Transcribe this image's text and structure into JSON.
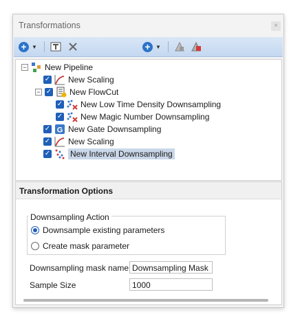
{
  "window": {
    "title": "Transformations",
    "close_glyph": "×"
  },
  "toolbar": {
    "add_icon": "plus-circle-icon",
    "text_icon": "text-box-icon",
    "delete_icon": "x-delete-icon",
    "add2_icon": "plus-circle-icon",
    "gate_icon": "gate-icon",
    "gate2_icon": "gate-colored-icon"
  },
  "tree": {
    "root": "New Pipeline",
    "items": [
      {
        "label": "New Scaling",
        "icon": "scaling-icon"
      },
      {
        "label": "New FlowCut",
        "icon": "flowcut-icon"
      },
      {
        "label": "New Low Time Density Downsampling",
        "icon": "downsample-icon"
      },
      {
        "label": "New Magic Number Downsampling",
        "icon": "downsample-icon"
      },
      {
        "label": "New Gate Downsampling",
        "icon": "gate-g-icon"
      },
      {
        "label": "New Scaling",
        "icon": "scaling-icon"
      },
      {
        "label": "New Interval Downsampling",
        "icon": "interval-icon"
      }
    ]
  },
  "options": {
    "header": "Transformation Options",
    "group_label": "Downsampling Action",
    "radio_existing": "Downsample existing parameters",
    "radio_mask": "Create mask parameter",
    "mask_name_label": "Downsampling mask name",
    "mask_name_value": "Downsampling Mask",
    "sample_size_label": "Sample Size",
    "sample_size_value": "1000"
  }
}
